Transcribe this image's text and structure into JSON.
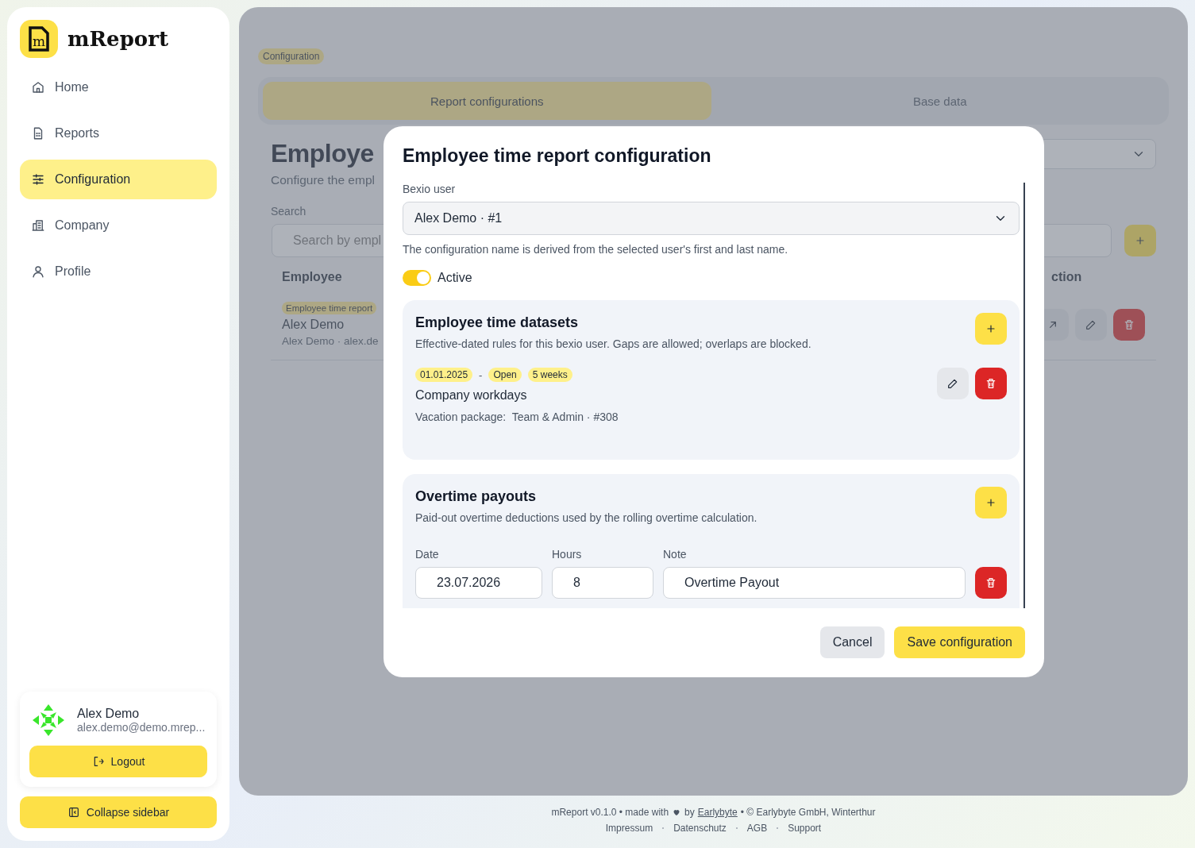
{
  "app": {
    "name": "mReport",
    "logo_letter": "m"
  },
  "nav": [
    {
      "kind": "home",
      "label": "Home",
      "selected": false
    },
    {
      "kind": "reports",
      "label": "Reports",
      "selected": false
    },
    {
      "kind": "configuration",
      "label": "Configuration",
      "selected": true
    },
    {
      "kind": "company",
      "label": "Company",
      "selected": false
    },
    {
      "kind": "profile",
      "label": "Profile",
      "selected": false
    }
  ],
  "user": {
    "name": "Alex Demo",
    "email": "alex.demo@demo.mrep...",
    "logout": "Logout"
  },
  "collapse": "Collapse sidebar",
  "breadcrumb": "Configuration",
  "tabs": [
    {
      "label": "Report configurations",
      "selected": true
    },
    {
      "label": "Base data",
      "selected": false
    }
  ],
  "page": {
    "title": "Employe",
    "subtitle": "Configure the empl",
    "search_label": "Search",
    "search_placeholder": "Search by empl"
  },
  "table": {
    "columns": [
      "Employee",
      "ction"
    ],
    "rows": [
      {
        "badge": "Employee time report",
        "name": "Alex Demo",
        "detail": "Alex Demo · alex.de"
      }
    ]
  },
  "modal": {
    "title": "Employee time report configuration",
    "user_field": {
      "label": "Bexio user",
      "value": "Alex Demo · #1",
      "hint": "The configuration name is derived from the selected user's first and last name."
    },
    "active": {
      "label": "Active",
      "on": true
    },
    "datasets": {
      "title": "Employee time datasets",
      "description": "Effective-dated rules for this bexio user. Gaps are allowed; overlaps are blocked.",
      "items": [
        {
          "from": "01.01.2025",
          "separator": "-",
          "to": "Open",
          "vacation": "5 weeks",
          "name": "Company workdays",
          "package_label": "Vacation package:",
          "package": "Team & Admin · #308"
        }
      ]
    },
    "payouts": {
      "title": "Overtime payouts",
      "description": "Paid-out overtime deductions used by the rolling overtime calculation.",
      "columns": [
        "Date",
        "Hours",
        "Note"
      ],
      "rows": [
        {
          "date": "23.07.2026",
          "hours": "8",
          "note": "Overtime Payout"
        }
      ]
    },
    "cancel": "Cancel",
    "save": "Save configuration"
  },
  "footer": {
    "prefix": "mReport v0.1.0 • made with",
    "by": "by",
    "link": "Earlybyte",
    "suffix": "• © Earlybyte GmbH, Winterthur",
    "links": [
      "Impressum",
      "Datenschutz",
      "AGB",
      "Support"
    ]
  }
}
